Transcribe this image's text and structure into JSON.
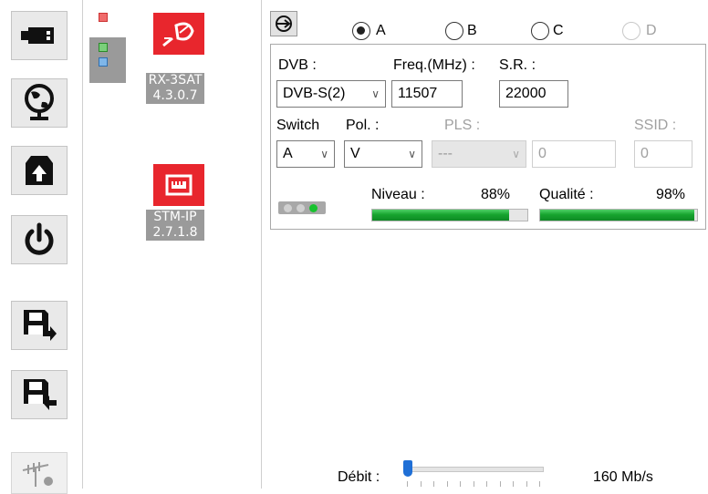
{
  "sidebar_tools": [
    {
      "name": "usb-icon"
    },
    {
      "name": "globe-icon"
    },
    {
      "name": "firmware-box-icon"
    },
    {
      "name": "power-icon"
    },
    {
      "name": "save-export-icon"
    },
    {
      "name": "save-import-icon"
    },
    {
      "name": "antenna-icon"
    }
  ],
  "devices": [
    {
      "icon": "satellite-dish-icon",
      "name": "RX-3SAT",
      "version": "4.3.0.7"
    },
    {
      "icon": "ethernet-port-icon",
      "name": "STM-IP",
      "version": "2.7.1.8"
    }
  ],
  "tuner": {
    "inputs": [
      {
        "label": "A",
        "selected": true,
        "enabled": true
      },
      {
        "label": "B",
        "selected": false,
        "enabled": true
      },
      {
        "label": "C",
        "selected": false,
        "enabled": true
      },
      {
        "label": "D",
        "selected": false,
        "enabled": false
      }
    ],
    "dvb_label": "DVB :",
    "dvb_value": "DVB-S(2)",
    "freq_label": "Freq.(MHz) :",
    "freq_value": "11507",
    "sr_label": "S.R. :",
    "sr_value": "22000",
    "switch_label": "Switch",
    "switch_value": "A",
    "pol_label": "Pol. :",
    "pol_value": "V",
    "pls_label": "PLS :",
    "pls_select": "---",
    "pls_value": "0",
    "ssid_label": "SSID :",
    "ssid_value": "0",
    "niveau_label": "Niveau :",
    "niveau_value": "88%",
    "niveau_fraction": 0.88,
    "qualite_label": "Qualité :",
    "qualite_value": "98%",
    "qualite_fraction": 0.98
  },
  "debit": {
    "label": "Débit :",
    "value": "160 Mb/s",
    "slider_fraction": 0.0
  },
  "colors": {
    "device_red": "#e8262d",
    "signal_green": "#17a52f"
  }
}
